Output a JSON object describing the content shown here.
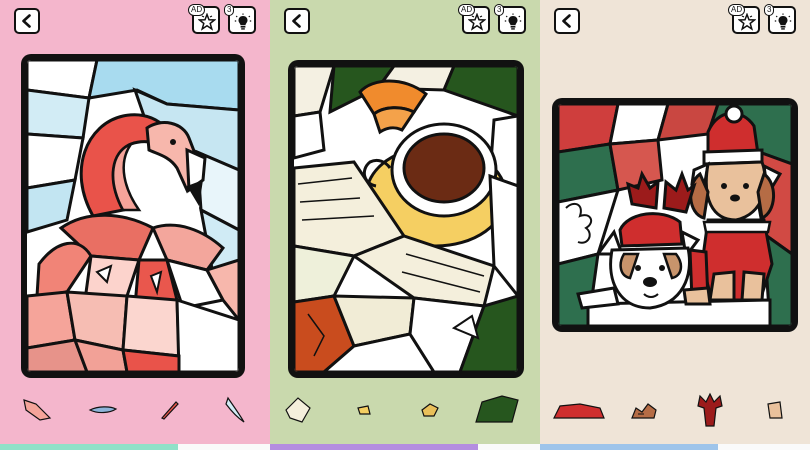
{
  "panels": [
    {
      "bg": "#f4b6cc",
      "progress_color": "#8fe1c8",
      "progress": 0.66,
      "ad_badge": "AD",
      "hint_badge": "3",
      "scene": "flamingo"
    },
    {
      "bg": "#c9d9ad",
      "progress_color": "#b48de0",
      "progress": 0.77,
      "ad_badge": "AD",
      "hint_badge": "3",
      "scene": "coffee-and-book"
    },
    {
      "bg": "#efe4d7",
      "progress_color": "#9ec4ea",
      "progress": 0.66,
      "ad_badge": "AD",
      "hint_badge": "3",
      "scene": "christmas-dogs"
    }
  ],
  "icons": {
    "back": "chevron-left-icon",
    "ad_star": "ad-star-icon",
    "hint": "lightbulb-icon"
  }
}
